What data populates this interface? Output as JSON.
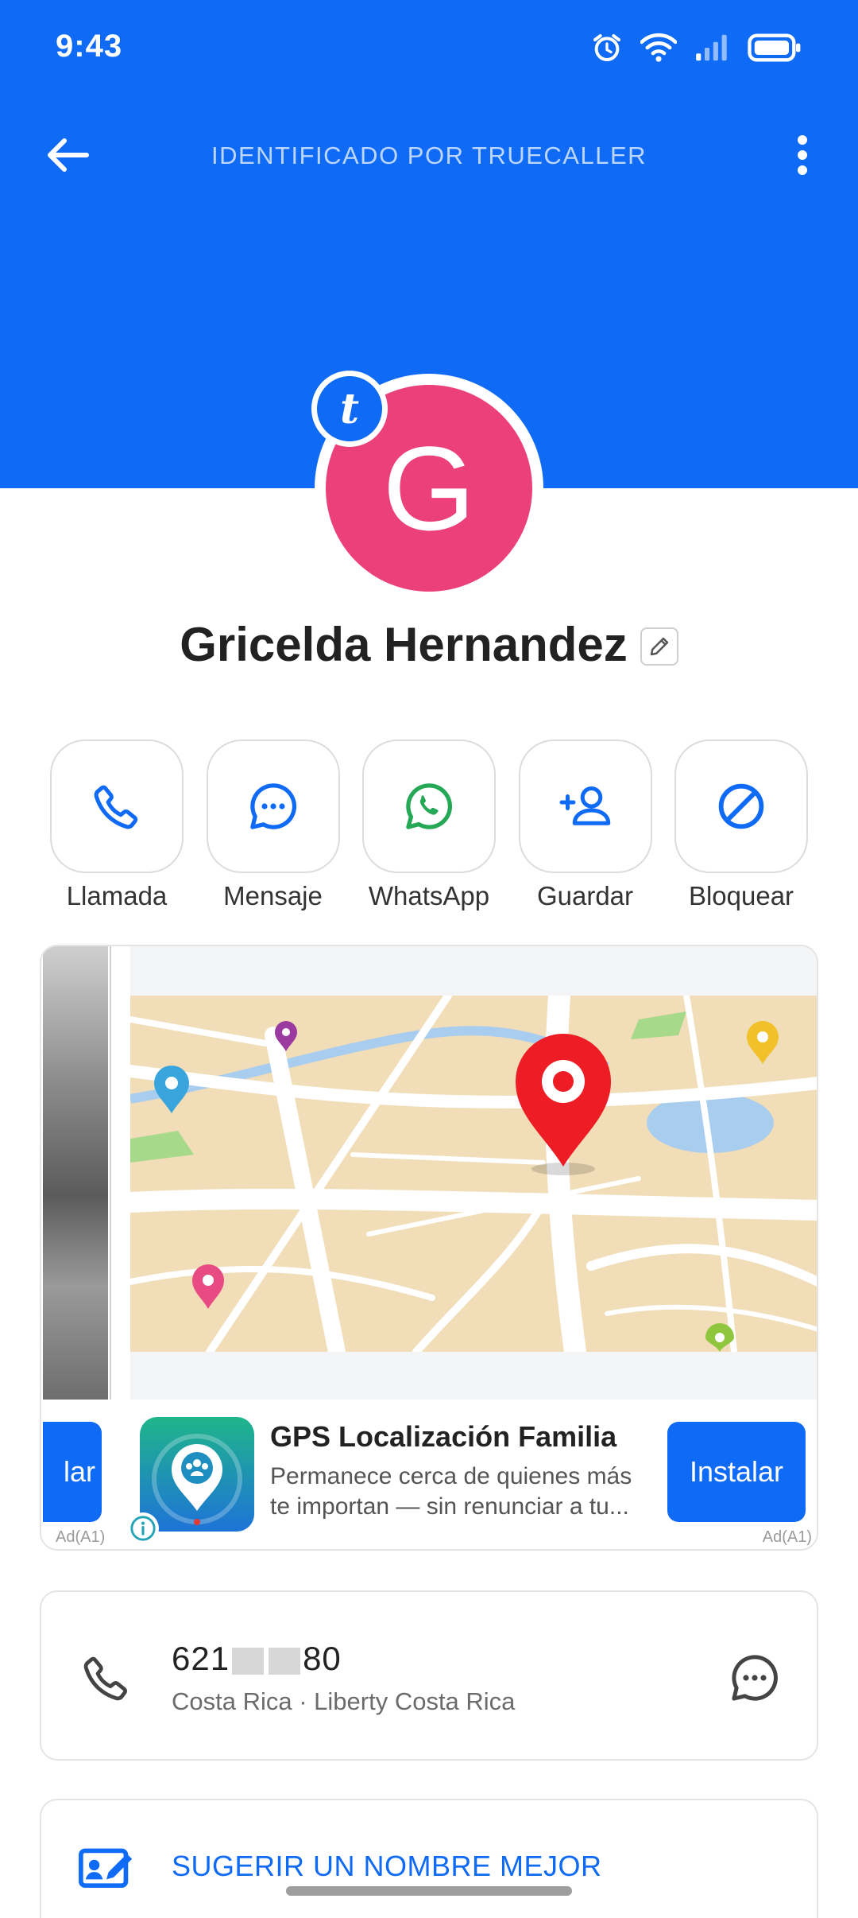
{
  "status_bar": {
    "time": "9:43",
    "icons": [
      "alarm-icon",
      "wifi-icon",
      "signal-icon",
      "battery-icon"
    ]
  },
  "toolbar": {
    "title": "IDENTIFICADO POR TRUECALLER",
    "back_icon": "arrow-left-icon",
    "menu_icon": "more-vertical-icon"
  },
  "contact": {
    "avatar_letter": "G",
    "badge_letter": "t",
    "name": "Gricelda Hernandez"
  },
  "actions": [
    {
      "label": "Llamada",
      "icon": "phone-icon"
    },
    {
      "label": "Mensaje",
      "icon": "message-icon"
    },
    {
      "label": "WhatsApp",
      "icon": "whatsapp-icon"
    },
    {
      "label": "Guardar",
      "icon": "add-contact-icon"
    },
    {
      "label": "Bloquear",
      "icon": "block-icon"
    }
  ],
  "ad": {
    "prev_button_text": "lar",
    "prev_tag": "Ad(A1)",
    "title": "GPS Localización Familia",
    "description_line1": "Permanece cerca de quienes más",
    "description_line2": "te importan — sin renunciar a tu...",
    "install_label": "Instalar",
    "tag": "Ad(A1)"
  },
  "phone": {
    "number_prefix": "621",
    "number_suffix": "80",
    "detail": "Costa Rica · Liberty Costa Rica"
  },
  "suggest": {
    "label": "SUGERIR UN NOMBRE MEJOR"
  },
  "colors": {
    "brand_blue": "#0f6af5",
    "avatar_pink": "#ec407a",
    "whatsapp_green": "#25a855"
  }
}
